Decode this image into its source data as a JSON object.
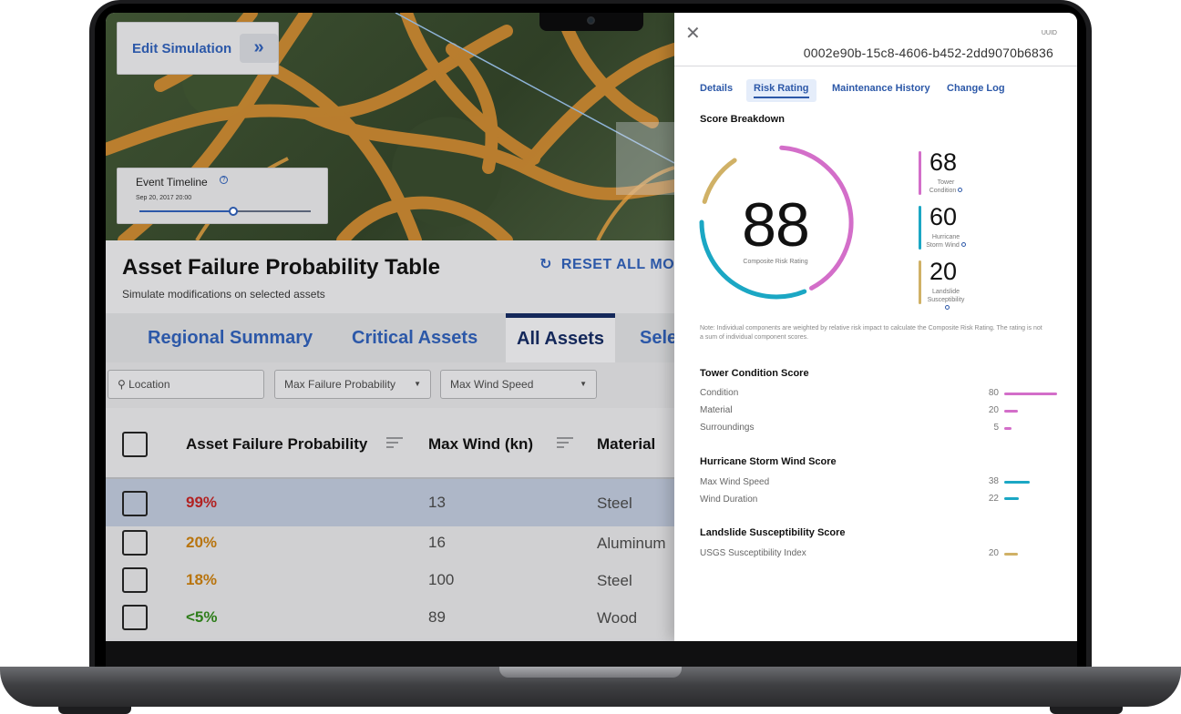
{
  "left_app": {
    "edit_simulation": {
      "label": "Edit Simulation",
      "button_glyph": "»"
    },
    "event_timeline": {
      "title": "Event Timeline",
      "date": "Sep 20, 2017 20:00",
      "position": 0.55
    },
    "table": {
      "title": "Asset Failure Probability Table",
      "subtitle": "Simulate modifications on selected assets",
      "reset_label": "RESET ALL MO",
      "tabs": [
        {
          "label": "Regional Summary"
        },
        {
          "label": "Critical Assets"
        },
        {
          "label": "All Assets"
        },
        {
          "label": "Sele"
        }
      ],
      "filters": {
        "location_placeholder": "Location",
        "max_failure": "Max Failure Probability",
        "max_wind": "Max Wind Speed"
      },
      "columns": [
        "Asset Failure Probability",
        "Max Wind (kn)",
        "Material"
      ],
      "rows": [
        {
          "prob": "99%",
          "wind": "13",
          "material": "Steel",
          "color": "#b22222"
        },
        {
          "prob": "20%",
          "wind": "16",
          "material": "Aluminum",
          "color": "#b8740e"
        },
        {
          "prob": "18%",
          "wind": "100",
          "material": "Steel",
          "color": "#b8740e"
        },
        {
          "prob": "<5%",
          "wind": "89",
          "material": "Wood",
          "color": "#2e7d1a"
        }
      ]
    }
  },
  "panel": {
    "close_glyph": "✕",
    "uuid_label": "UUID",
    "uuid_value": "0002e90b-15c8-4606-b452-2dd9070b6836",
    "tabs": [
      {
        "label": "Details"
      },
      {
        "label": "Risk Rating"
      },
      {
        "label": "Maintenance History"
      },
      {
        "label": "Change Log"
      }
    ],
    "score_breakdown_title": "Score Breakdown",
    "composite": {
      "value": "88",
      "label": "Composite Risk Rating"
    },
    "sub_scores": [
      {
        "value": "68",
        "name_line1": "Tower",
        "name_line2": "Condition",
        "color": "#d36ec9"
      },
      {
        "value": "60",
        "name_line1": "Hurricane",
        "name_line2": "Storm Wind",
        "color": "#1ba7c4"
      },
      {
        "value": "20",
        "name_line1": "Landslide",
        "name_line2": "Susceptibility",
        "color": "#d0b166"
      }
    ],
    "note": "Note: Individual components are weighted by relative risk impact to calculate the Composite Risk Rating. The rating is not a sum of individual component scores.",
    "sections": [
      {
        "title": "Tower Condition Score",
        "color": "#d36ec9",
        "metrics": [
          {
            "name": "Condition",
            "value": "80"
          },
          {
            "name": "Material",
            "value": "20"
          },
          {
            "name": "Surroundings",
            "value": "5"
          }
        ]
      },
      {
        "title": "Hurricane Storm Wind Score",
        "color": "#1ba7c4",
        "metrics": [
          {
            "name": "Max Wind Speed",
            "value": "38"
          },
          {
            "name": "Wind Duration",
            "value": "22"
          }
        ]
      },
      {
        "title": "Landslide Susceptibility Score",
        "color": "#d0b166",
        "metrics": [
          {
            "name": "USGS Susceptibility Index",
            "value": "20"
          }
        ]
      }
    ]
  }
}
